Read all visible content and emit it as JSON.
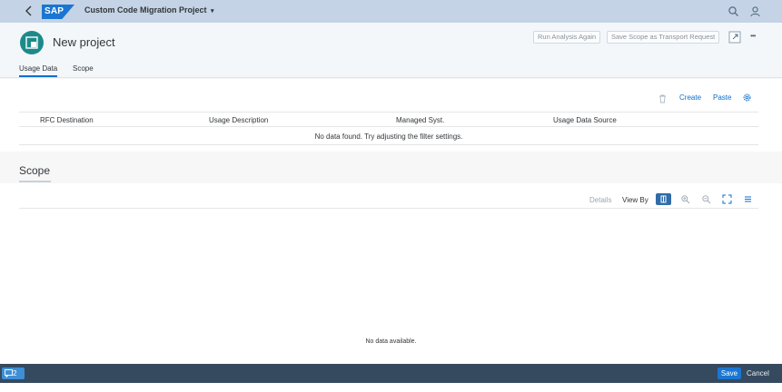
{
  "shell": {
    "logo": "SAP",
    "title": "Custom Code Migration Project",
    "caret": "▾",
    "icons": [
      "back-icon",
      "search-icon",
      "user-icon"
    ]
  },
  "header": {
    "title": "New project",
    "buttons": {
      "run_analysis": "Run Analysis Again",
      "save_scope": "Save Scope as Transport Request"
    },
    "icons": [
      "project-icon",
      "share-icon",
      "more-icon"
    ],
    "more": "•••"
  },
  "tabs": [
    {
      "label": "Usage Data",
      "active": true
    },
    {
      "label": "Scope",
      "active": false
    }
  ],
  "usage_table": {
    "toolbar": {
      "create": "Create",
      "paste": "Paste",
      "icons": [
        "delete-icon",
        "settings-icon"
      ]
    },
    "columns": [
      "RFC Destination",
      "Usage Description",
      "Managed Syst.",
      "Usage Data Source"
    ],
    "empty_text": "No data found. Try adjusting the filter settings."
  },
  "scope": {
    "title": "Scope",
    "toolbar": {
      "details": "Details",
      "view_by": "View By"
    },
    "icons": [
      "view-by-icon",
      "zoom-in-icon",
      "zoom-out-icon",
      "fullscreen-icon",
      "list-icon"
    ],
    "empty_text": "No data available."
  },
  "footer": {
    "message_count": "2",
    "save": "Save",
    "cancel": "Cancel"
  },
  "colors": {
    "shell": "#c4d3e5",
    "accent": "#0a6ed1",
    "avatar": "#1d8a8a",
    "footer": "#354a5f"
  }
}
